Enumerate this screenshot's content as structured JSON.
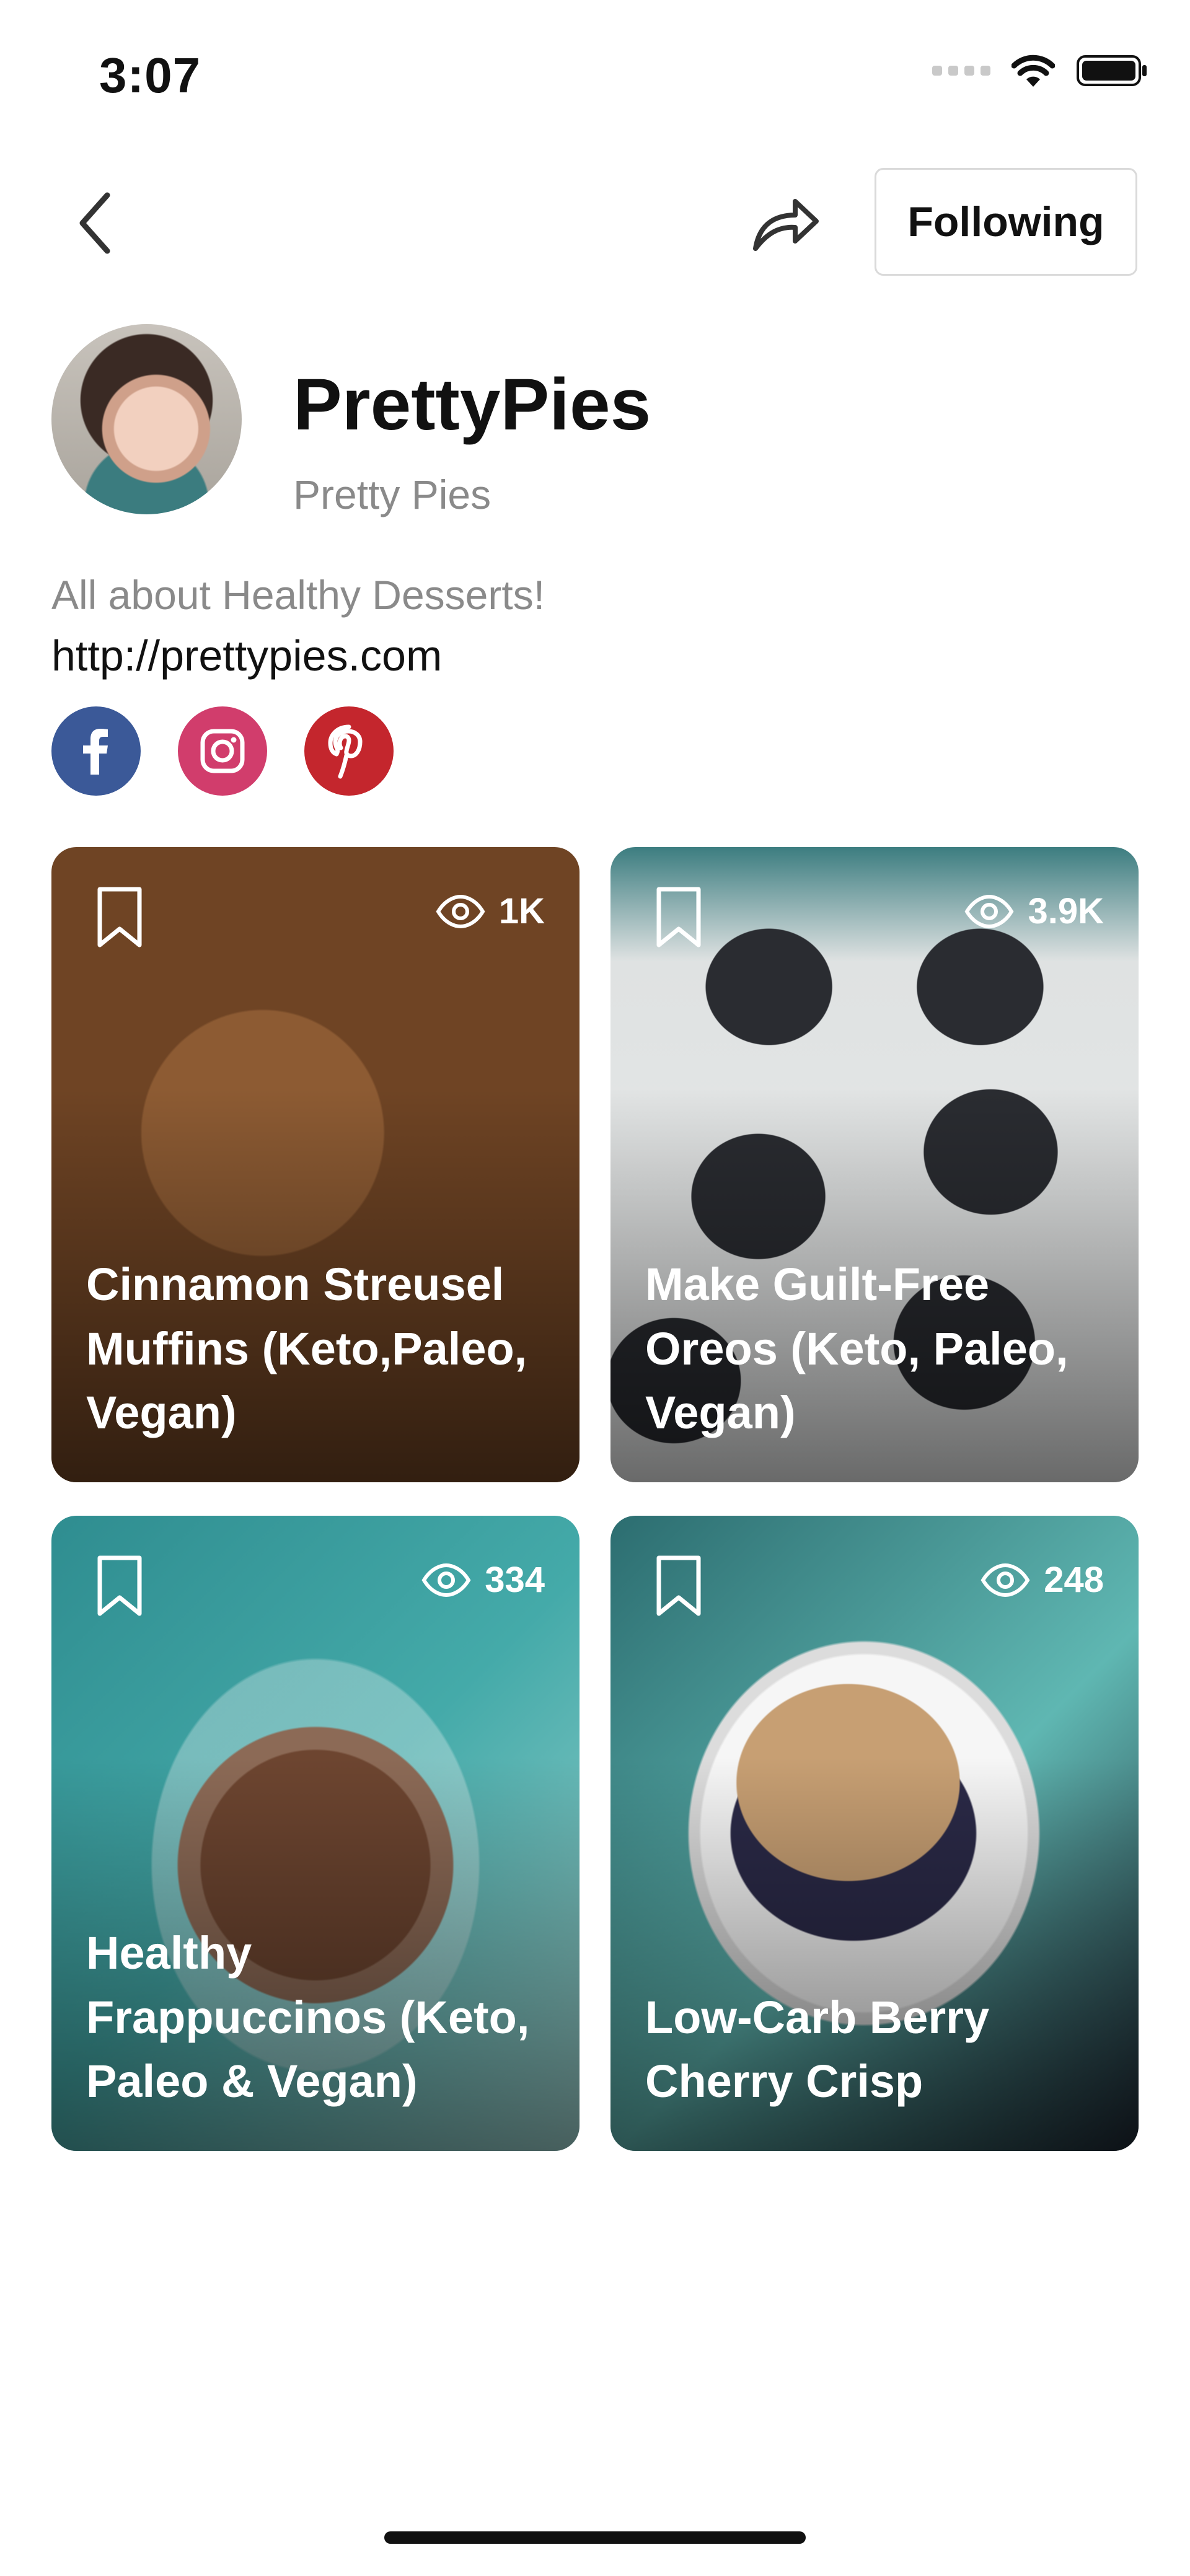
{
  "status_bar": {
    "time": "3:07"
  },
  "header": {
    "following_label": "Following"
  },
  "profile": {
    "username": "PrettyPies",
    "display_name": "Pretty Pies",
    "bio": "All about Healthy Desserts!",
    "website": "http://prettypies.com",
    "socials": [
      {
        "name": "facebook",
        "icon": "facebook-icon",
        "color": "#3b5998"
      },
      {
        "name": "instagram",
        "icon": "instagram-icon",
        "color": "#d13d6c"
      },
      {
        "name": "pinterest",
        "icon": "pinterest-icon",
        "color": "#c4262d"
      }
    ]
  },
  "recipes": [
    {
      "title": "Cinnamon Streusel Muffins (Keto,Paleo, Vegan)",
      "views": "1K"
    },
    {
      "title": "Make Guilt-Free Oreos (Keto, Paleo, Vegan)",
      "views": "3.9K"
    },
    {
      "title": "Healthy Frappuccinos (Keto, Paleo & Vegan)",
      "views": "334"
    },
    {
      "title": "Low-Carb Berry Cherry Crisp",
      "views": "248"
    }
  ]
}
